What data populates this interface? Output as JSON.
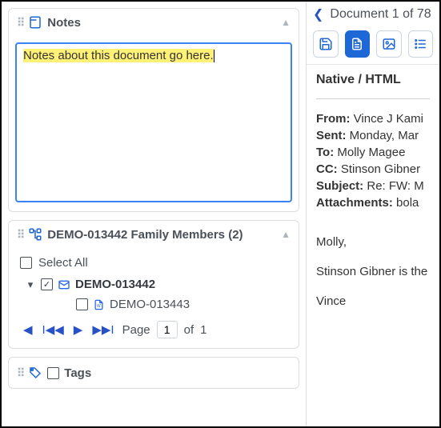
{
  "notes": {
    "title": "Notes",
    "value": "Notes about this document go here."
  },
  "family": {
    "title": "DEMO-013442 Family Members (2)",
    "select_all": "Select All",
    "items": {
      "parent": {
        "id": "DEMO-013442",
        "checked": true
      },
      "child": {
        "id": "DEMO-013443",
        "checked": false
      }
    },
    "pager": {
      "page_label": "Page",
      "of_label": "of",
      "current": "1",
      "total": "1"
    }
  },
  "tags": {
    "title": "Tags"
  },
  "viewer": {
    "counter": "Document 1 of 78",
    "section_title": "Native / HTML",
    "meta": {
      "from_k": "From:",
      "from_v": "Vince J Kami",
      "sent_k": "Sent:",
      "sent_v": "Monday, Mar",
      "to_k": "To:",
      "to_v": "Molly Magee",
      "cc_k": "CC:",
      "cc_v": "Stinson Gibner",
      "subj_k": "Subject:",
      "subj_v": "Re: FW: M",
      "att_k": "Attachments:",
      "att_v": "bola"
    },
    "body": {
      "l1": "Molly,",
      "l2": "Stinson Gibner is the",
      "l3": "Vince"
    }
  }
}
